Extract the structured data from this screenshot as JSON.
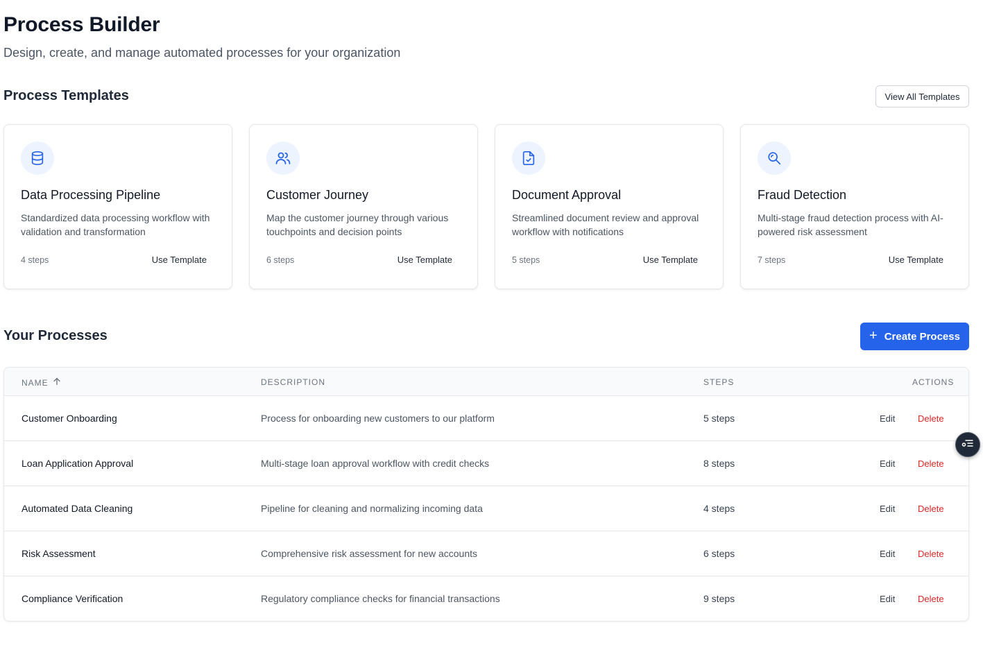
{
  "header": {
    "title": "Process Builder",
    "subtitle": "Design, create, and manage automated processes for your organization"
  },
  "templates": {
    "section_title": "Process Templates",
    "view_all_label": "View All Templates",
    "items": [
      {
        "icon": "database-icon",
        "title": "Data Processing Pipeline",
        "description": "Standardized data processing workflow with validation and transformation",
        "steps": "4 steps",
        "action": "Use Template"
      },
      {
        "icon": "users-icon",
        "title": "Customer Journey",
        "description": "Map the customer journey through various touchpoints and decision points",
        "steps": "6 steps",
        "action": "Use Template"
      },
      {
        "icon": "file-check-icon",
        "title": "Document Approval",
        "description": "Streamlined document review and approval workflow with notifications",
        "steps": "5 steps",
        "action": "Use Template"
      },
      {
        "icon": "search-icon",
        "title": "Fraud Detection",
        "description": "Multi-stage fraud detection process with AI-powered risk assessment",
        "steps": "7 steps",
        "action": "Use Template"
      }
    ]
  },
  "processes": {
    "section_title": "Your Processes",
    "create_label": "Create Process",
    "columns": {
      "name": "Name",
      "description": "Description",
      "steps": "Steps",
      "actions": "Actions"
    },
    "rows": [
      {
        "name": "Customer Onboarding",
        "description": "Process for onboarding new customers to our platform",
        "steps": "5 steps",
        "edit": "Edit",
        "delete": "Delete"
      },
      {
        "name": "Loan Application Approval",
        "description": "Multi-stage loan approval workflow with credit checks",
        "steps": "8 steps",
        "edit": "Edit",
        "delete": "Delete"
      },
      {
        "name": "Automated Data Cleaning",
        "description": "Pipeline for cleaning and normalizing incoming data",
        "steps": "4 steps",
        "edit": "Edit",
        "delete": "Delete"
      },
      {
        "name": "Risk Assessment",
        "description": "Comprehensive risk assessment for new accounts",
        "steps": "6 steps",
        "edit": "Edit",
        "delete": "Delete"
      },
      {
        "name": "Compliance Verification",
        "description": "Regulatory compliance checks for financial transactions",
        "steps": "9 steps",
        "edit": "Edit",
        "delete": "Delete"
      }
    ]
  },
  "colors": {
    "primary": "#2563eb",
    "danger": "#dc2626",
    "icon_bg": "#eef4ff"
  }
}
